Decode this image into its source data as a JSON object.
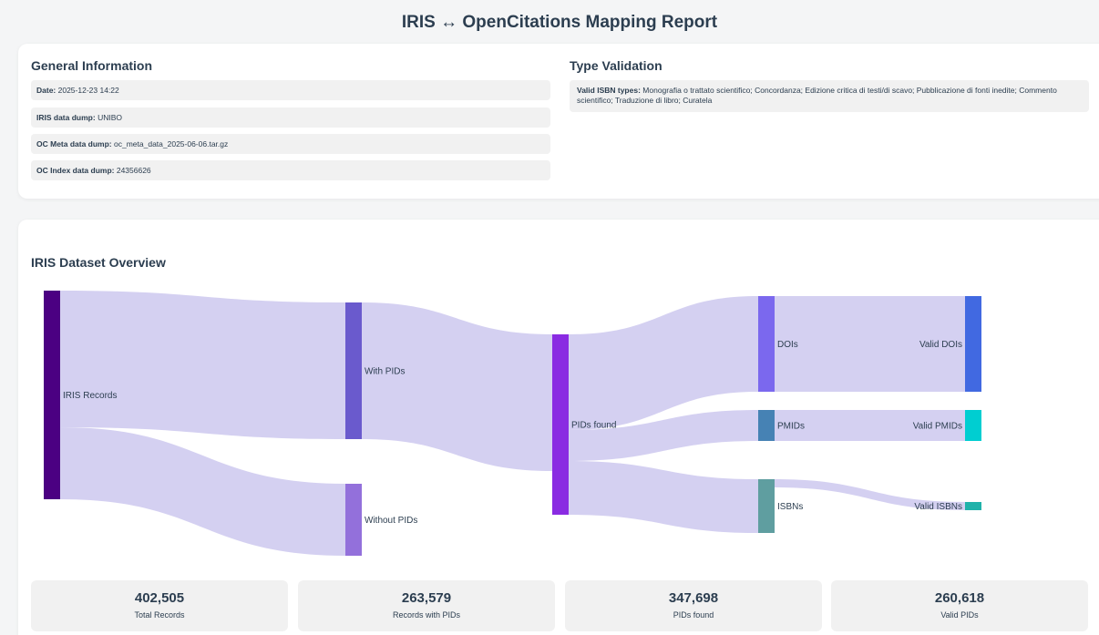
{
  "page": {
    "title": "IRIS ↔ OpenCitations Mapping Report"
  },
  "general_info": {
    "heading": "General Information",
    "rows": [
      {
        "label": "Date:",
        "value": " 2025-12-23 14:22"
      },
      {
        "label": "IRIS data dump:",
        "value": " UNIBO"
      },
      {
        "label": "OC Meta data dump:",
        "value": " oc_meta_data_2025-06-06.tar.gz"
      },
      {
        "label": "OC Index data dump:",
        "value": " 24356626"
      }
    ]
  },
  "type_validation": {
    "heading": "Type Validation",
    "label": "Valid ISBN types:",
    "value": " Monografia o trattato scientifico; Concordanza; Edizione critica di testi/di scavo; Pubblicazione di fonti inedite; Commento scientifico; Traduzione di libro; Curatela"
  },
  "overview": {
    "heading": "IRIS Dataset Overview"
  },
  "sankey": {
    "colors": {
      "link": "#d2cdf0",
      "iris_records": "#4b0082",
      "with_pids": "#6a5acd",
      "without_pids": "#9370db",
      "pids_found": "#8a2be2",
      "dois": "#7b68ee",
      "pmids": "#4682b4",
      "isbns": "#5f9ea0",
      "valid_dois": "#4169e1",
      "valid_pmids": "#00ced1",
      "valid_isbns": "#20b2aa"
    },
    "nodes": [
      {
        "id": "iris_records",
        "label": "IRIS Records"
      },
      {
        "id": "with_pids",
        "label": "With PIDs"
      },
      {
        "id": "without_pids",
        "label": "Without PIDs"
      },
      {
        "id": "pids_found",
        "label": "PIDs found"
      },
      {
        "id": "dois",
        "label": "DOIs"
      },
      {
        "id": "pmids",
        "label": "PMIDs"
      },
      {
        "id": "isbns",
        "label": "ISBNs"
      },
      {
        "id": "valid_dois",
        "label": "Valid DOIs"
      },
      {
        "id": "valid_pmids",
        "label": "Valid PMIDs"
      },
      {
        "id": "valid_isbns",
        "label": "Valid ISBNs"
      }
    ]
  },
  "stats": [
    {
      "value": "402,505",
      "label": "Total Records"
    },
    {
      "value": "263,579",
      "label": "Records with PIDs"
    },
    {
      "value": "347,698",
      "label": "PIDs found"
    },
    {
      "value": "260,618",
      "label": "Valid PIDs"
    }
  ]
}
